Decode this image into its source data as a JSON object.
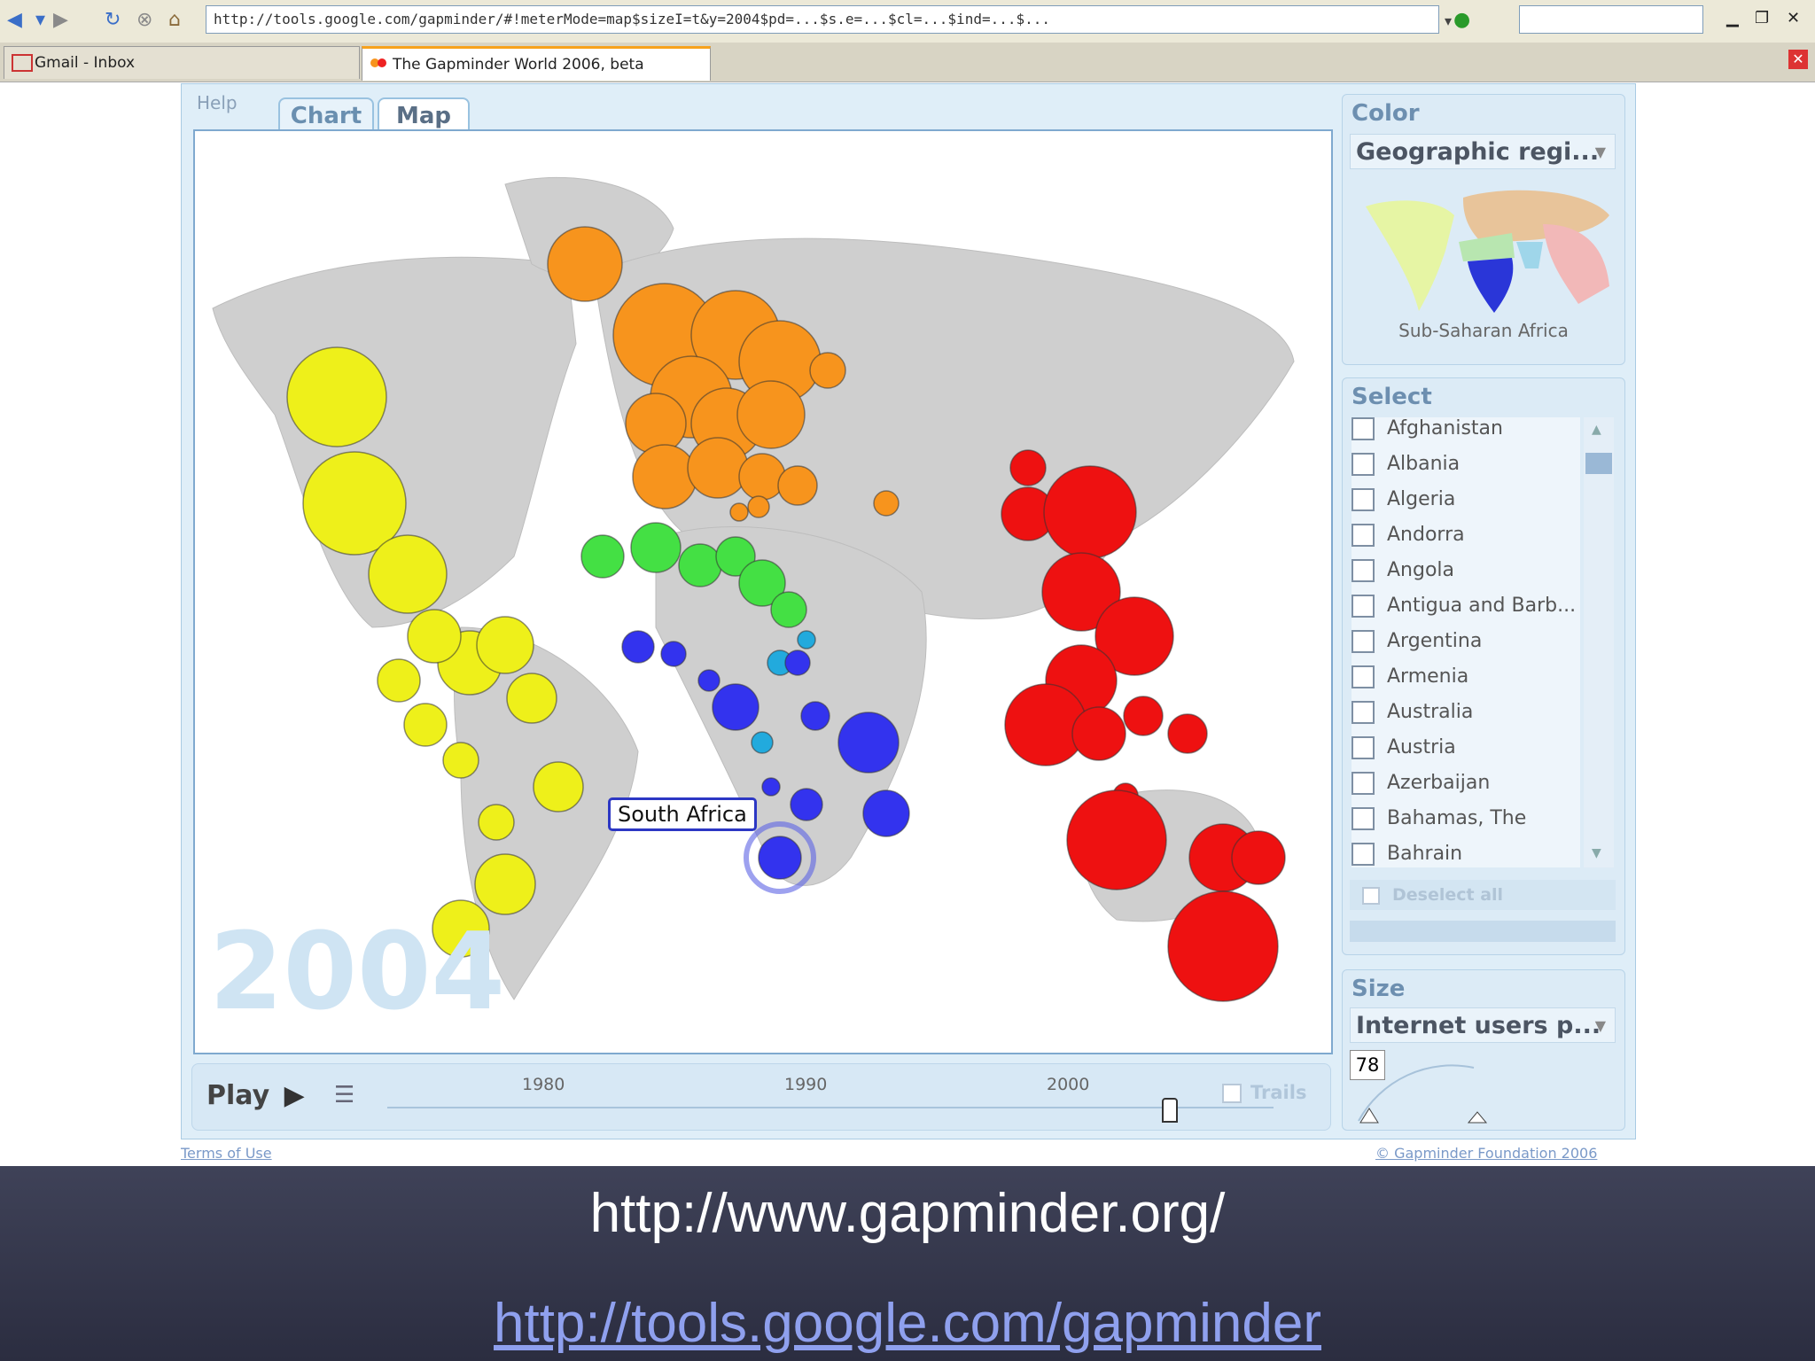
{
  "browser": {
    "url": "http://tools.google.com/gapminder/#!meterMode=map$sizeI=t&y=2004$pd=...$s.e=...$cl=...$ind=...$...",
    "tabs": [
      {
        "label": "Gmail - Inbox"
      },
      {
        "label": "The Gapminder World 2006, beta"
      }
    ]
  },
  "app": {
    "help_label": "Help",
    "tabs": [
      {
        "label": "Chart"
      },
      {
        "label": "Map"
      }
    ],
    "year_watermark": "2004",
    "callout": "South Africa",
    "color_panel": {
      "title": "Color",
      "selected": "Geographic regi...",
      "legend_caption": "Sub-Saharan Africa"
    },
    "select_panel": {
      "title": "Select",
      "countries": [
        "Afghanistan",
        "Albania",
        "Algeria",
        "Andorra",
        "Angola",
        "Antigua and Barb...",
        "Argentina",
        "Armenia",
        "Australia",
        "Austria",
        "Azerbaijan",
        "Bahamas, The",
        "Bahrain"
      ],
      "deselect_label": "Deselect all"
    },
    "size_panel": {
      "title": "Size",
      "selected": "Internet users p...",
      "value": "78"
    },
    "timeline": {
      "play_label": "Play",
      "ticks": [
        "1980",
        "1990",
        "2000"
      ],
      "trails_label": "Trails",
      "position_year": 2004
    },
    "footer": {
      "terms": "Terms of Use",
      "copyright": "© Gapminder Foundation 2006"
    }
  },
  "slide": {
    "link1": "http://www.gapminder.org/",
    "link2": "http://tools.google.com/gapminder"
  },
  "colors": {
    "europe_central_asia": "#f7941d",
    "middle_east_north_africa": "#44e044",
    "sub_saharan_africa": "#3333ee",
    "south_asia": "#22aadd",
    "east_asia_pacific": "#ee1111",
    "america": "#eef01a",
    "land": "#cfcfcf"
  }
}
